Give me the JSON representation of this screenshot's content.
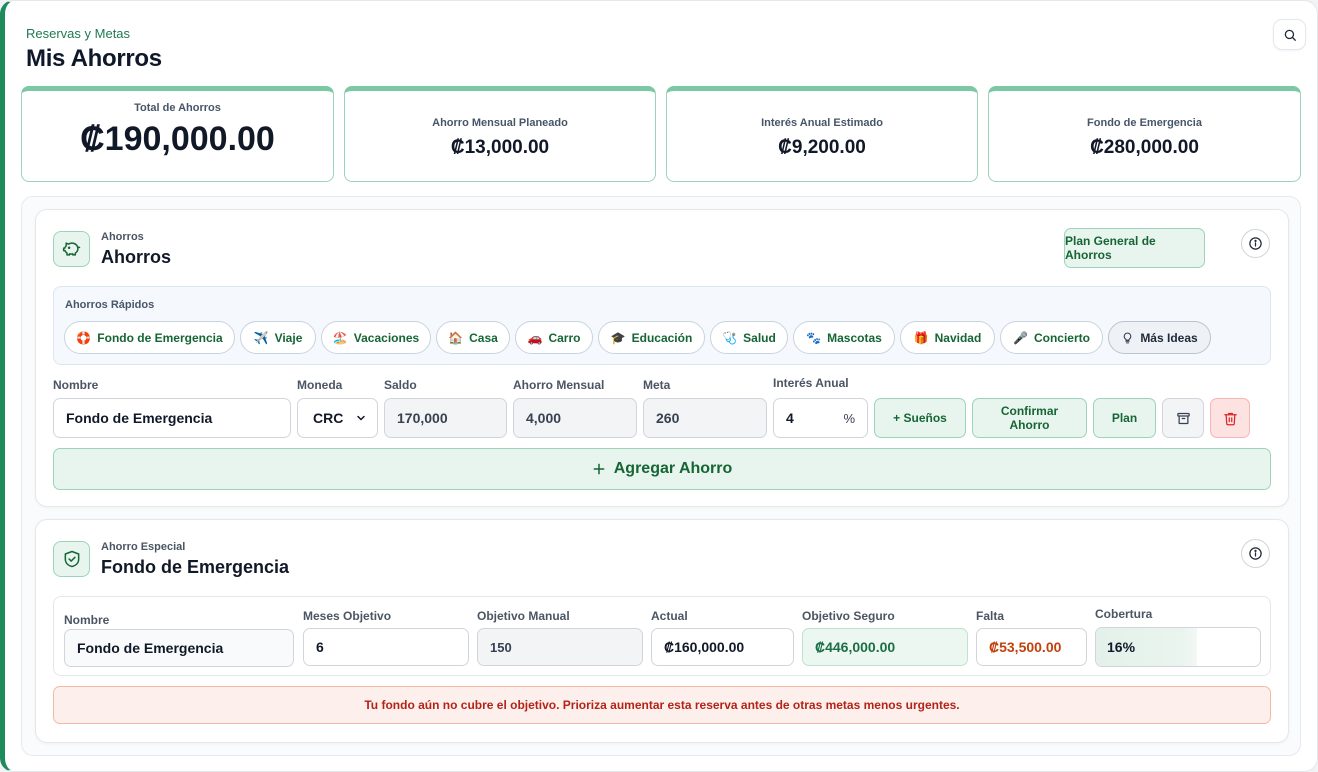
{
  "header": {
    "eyebrow": "Reservas y Metas",
    "title": "Mis Ahorros"
  },
  "stats": [
    {
      "label": "Total de Ahorros",
      "value": "₡190,000.00"
    },
    {
      "label": "Ahorro Mensual Planeado",
      "value": "₡13,000.00"
    },
    {
      "label": "Interés Anual Estimado",
      "value": "₡9,200.00"
    },
    {
      "label": "Fondo de Emergencia",
      "value": "₡280,000.00"
    }
  ],
  "ahorros": {
    "eyebrow": "Ahorros",
    "title": "Ahorros",
    "icon": "piggy-bank-icon",
    "plan_general": "Plan General de Ahorros",
    "quick_label": "Ahorros Rápidos",
    "quick": [
      {
        "label": "Fondo de Emergencia",
        "icon": "🛟"
      },
      {
        "label": "Viaje",
        "icon": "✈️"
      },
      {
        "label": "Vacaciones",
        "icon": "🏖️"
      },
      {
        "label": "Casa",
        "icon": "🏠"
      },
      {
        "label": "Carro",
        "icon": "🚗"
      },
      {
        "label": "Educación",
        "icon": "🎓"
      },
      {
        "label": "Salud",
        "icon": "🩺"
      },
      {
        "label": "Mascotas",
        "icon": "🐾"
      },
      {
        "label": "Navidad",
        "icon": "🎁"
      },
      {
        "label": "Concierto",
        "icon": "🎤"
      },
      {
        "label": "Más Ideas",
        "icon": "lightbulb-icon"
      }
    ],
    "labels": {
      "nombre": "Nombre",
      "moneda": "Moneda",
      "saldo": "Saldo",
      "mensual": "Ahorro Mensual",
      "meta": "Meta",
      "interes": "Interés Anual"
    },
    "row": {
      "nombre": "Fondo de Emergencia",
      "moneda": "CRC",
      "saldo": "170,000",
      "mensual": "4,000",
      "meta": "260",
      "interes": "4",
      "pct": "%"
    },
    "actions": {
      "suenos": "+ Sueños",
      "confirmar": "Confirmar Ahorro",
      "plan": "Plan"
    },
    "add_label": "Agregar Ahorro"
  },
  "emergencia": {
    "eyebrow": "Ahorro Especial",
    "title": "Fondo de Emergencia",
    "icon": "shield-check-icon",
    "labels": {
      "nombre": "Nombre",
      "meses": "Meses Objetivo",
      "manual": "Objetivo Manual",
      "actual": "Actual",
      "seguro": "Objetivo Seguro",
      "falta": "Falta",
      "cobertura": "Cobertura"
    },
    "values": {
      "nombre": "Fondo de Emergencia",
      "meses": "6",
      "manual": "150",
      "actual": "₡160,000.00",
      "seguro": "₡446,000.00",
      "falta": "₡53,500.00",
      "cobertura": "16%"
    },
    "coverage_fraction": 0.16,
    "alert": "Tu fondo aún no cubre el objetivo. Prioriza aumentar esta reserva antes de otras metas menos urgentes."
  },
  "colors": {
    "accent": "#1f8a5b",
    "accent_soft": "#e8f5ee",
    "danger": "#b42318"
  }
}
